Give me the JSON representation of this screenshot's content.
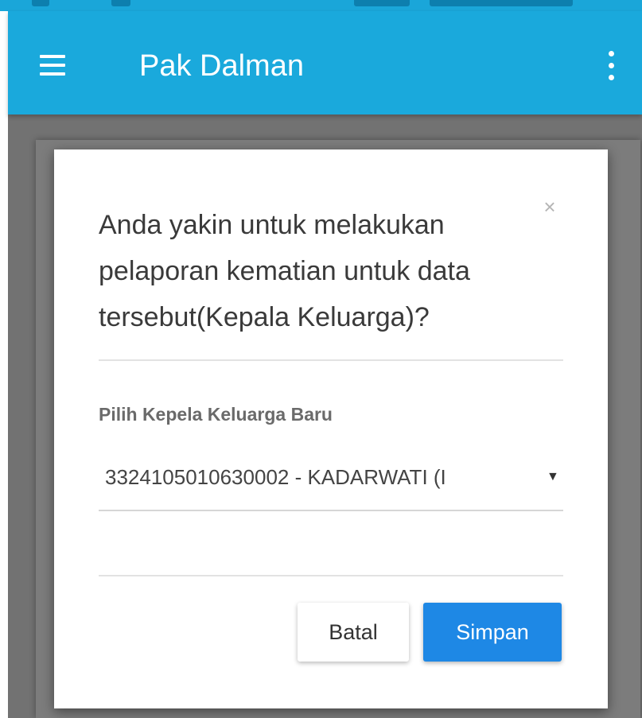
{
  "app_bar": {
    "title": "Pak Dalman",
    "menu_icon": "hamburger-menu-icon",
    "more_icon": "more-vertical-icon",
    "color": "#1aa9dc"
  },
  "dialog": {
    "title": "Anda yakin untuk melakukan pelaporan kematian untuk data tersebut(Kepala Keluarga)?",
    "close_label": "×",
    "field_label": "Pilih Kepela Keluarga Baru",
    "select_value": "3324105010630002 - KADARWATI (I",
    "select_caret": "▼",
    "cancel_label": "Batal",
    "save_label": "Simpan",
    "save_color": "#1e88e5"
  }
}
